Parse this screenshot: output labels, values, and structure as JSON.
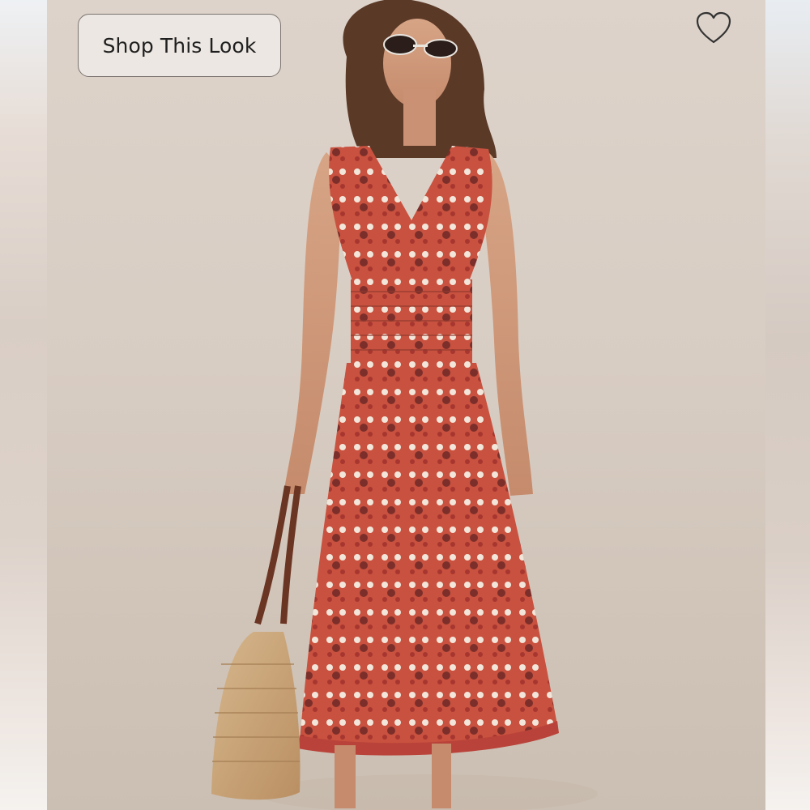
{
  "overlay": {
    "shop_button_label": "Shop This Look",
    "favorite_icon": "heart-outline-icon"
  },
  "photo": {
    "subject": "product-model-photo"
  },
  "colors": {
    "background": "#d9cec4",
    "dress": "#c9513f",
    "bag": "#c9a779",
    "strap": "#6b3523"
  }
}
